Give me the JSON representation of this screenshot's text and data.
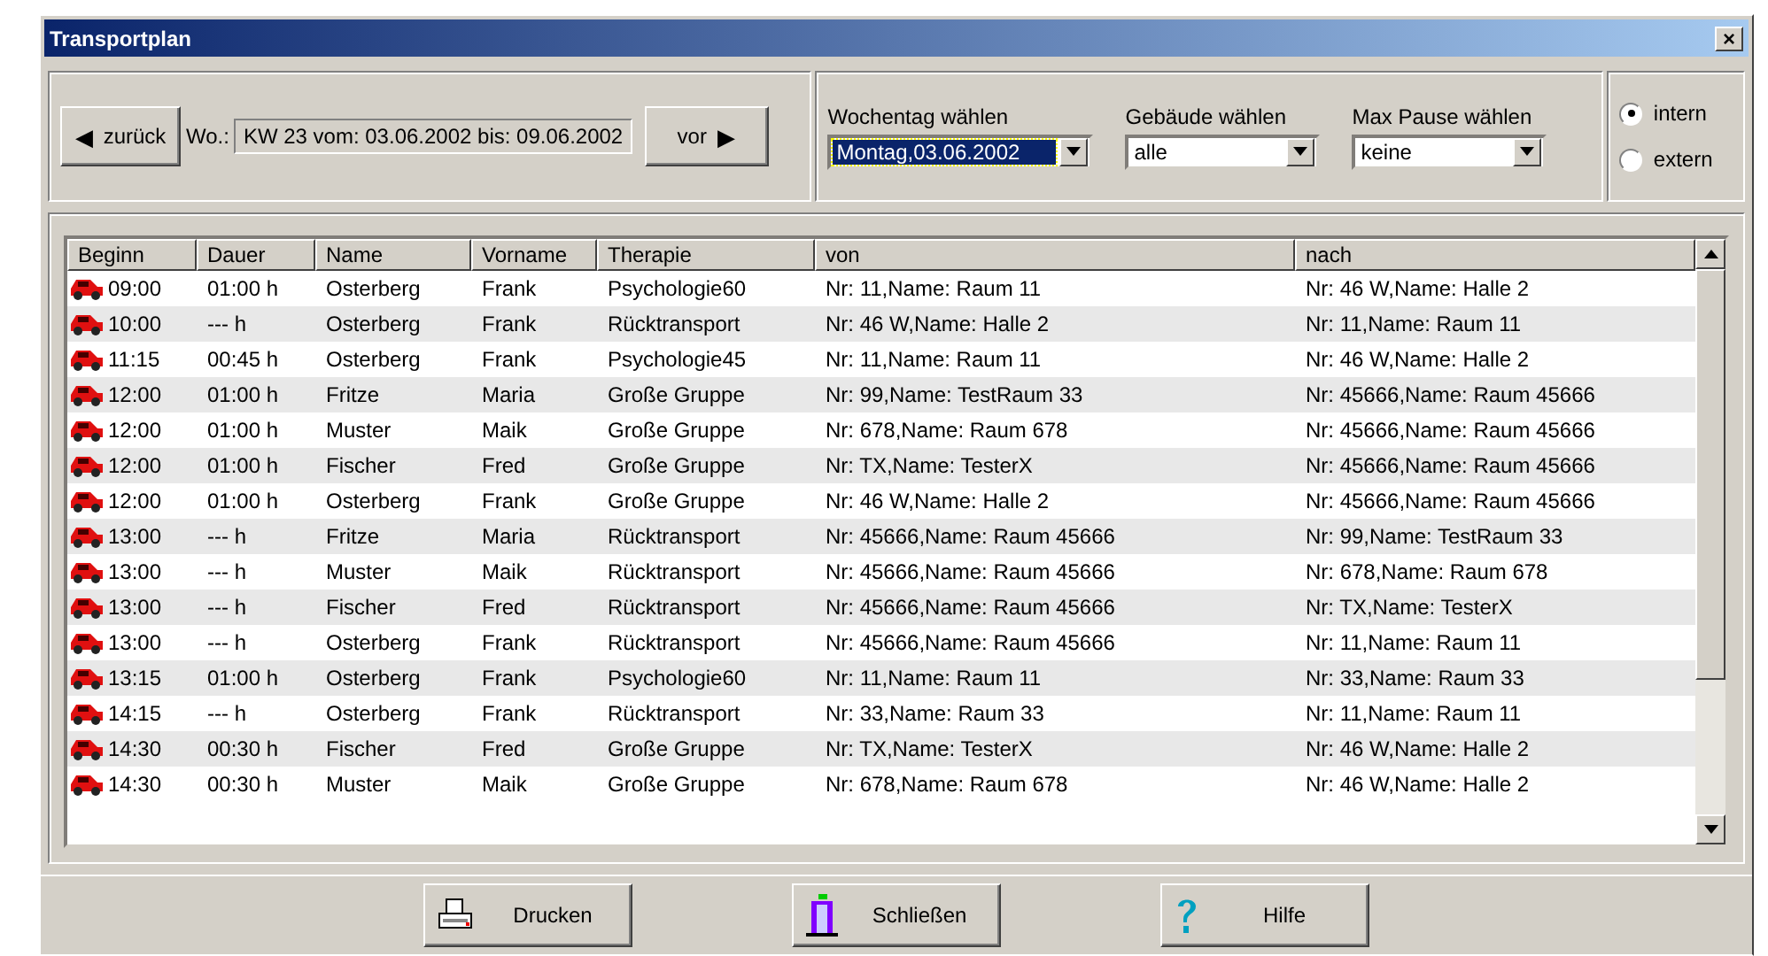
{
  "window": {
    "title": "Transportplan",
    "close": "×"
  },
  "week_nav": {
    "back": {
      "arrow": "◀",
      "label": "zurück"
    },
    "week_label": "Wo.:",
    "week_value": "KW 23 vom: 03.06.2002 bis: 09.06.2002",
    "forward": {
      "label": "vor",
      "arrow": "▶"
    }
  },
  "filters": [
    {
      "label": "Wochentag wählen",
      "value": "Montag,03.06.2002",
      "highlighted": true
    },
    {
      "label": "Gebäude wählen",
      "value": "alle",
      "highlighted": false
    },
    {
      "label": "Max Pause wählen",
      "value": "keine",
      "highlighted": false
    }
  ],
  "scope": [
    {
      "label": "intern",
      "selected": true
    },
    {
      "label": "extern",
      "selected": false
    }
  ],
  "table": {
    "columns": [
      "Beginn",
      "Dauer",
      "Name",
      "Vorname",
      "Therapie",
      "von",
      "nach"
    ],
    "rows": [
      [
        "09:00",
        "01:00 h",
        "Osterberg",
        "Frank",
        "Psychologie60",
        "Nr: 11,Name: Raum 11",
        "Nr: 46 W,Name: Halle 2"
      ],
      [
        "10:00",
        "--- h",
        "Osterberg",
        "Frank",
        "Rücktransport",
        "Nr: 46 W,Name: Halle 2",
        "Nr: 11,Name: Raum 11"
      ],
      [
        "11:15",
        "00:45 h",
        "Osterberg",
        "Frank",
        "Psychologie45",
        "Nr: 11,Name: Raum 11",
        "Nr: 46 W,Name: Halle 2"
      ],
      [
        "12:00",
        "01:00 h",
        "Fritze",
        "Maria",
        "Große Gruppe",
        "Nr: 99,Name: TestRaum 33",
        "Nr: 45666,Name: Raum 45666"
      ],
      [
        "12:00",
        "01:00 h",
        "Muster",
        "Maik",
        "Große Gruppe",
        "Nr: 678,Name: Raum 678",
        "Nr: 45666,Name: Raum 45666"
      ],
      [
        "12:00",
        "01:00 h",
        "Fischer",
        "Fred",
        "Große Gruppe",
        "Nr: TX,Name: TesterX",
        "Nr: 45666,Name: Raum 45666"
      ],
      [
        "12:00",
        "01:00 h",
        "Osterberg",
        "Frank",
        "Große Gruppe",
        "Nr: 46 W,Name: Halle 2",
        "Nr: 45666,Name: Raum 45666"
      ],
      [
        "13:00",
        "--- h",
        "Fritze",
        "Maria",
        "Rücktransport",
        "Nr: 45666,Name: Raum 45666",
        "Nr: 99,Name: TestRaum 33"
      ],
      [
        "13:00",
        "--- h",
        "Muster",
        "Maik",
        "Rücktransport",
        "Nr: 45666,Name: Raum 45666",
        "Nr: 678,Name: Raum 678"
      ],
      [
        "13:00",
        "--- h",
        "Fischer",
        "Fred",
        "Rücktransport",
        "Nr: 45666,Name: Raum 45666",
        "Nr: TX,Name: TesterX"
      ],
      [
        "13:00",
        "--- h",
        "Osterberg",
        "Frank",
        "Rücktransport",
        "Nr: 45666,Name: Raum 45666",
        "Nr: 11,Name: Raum 11"
      ],
      [
        "13:15",
        "01:00 h",
        "Osterberg",
        "Frank",
        "Psychologie60",
        "Nr: 11,Name: Raum 11",
        "Nr: 33,Name: Raum 33"
      ],
      [
        "14:15",
        "--- h",
        "Osterberg",
        "Frank",
        "Rücktransport",
        "Nr: 33,Name: Raum 33",
        "Nr: 11,Name: Raum 11"
      ],
      [
        "14:30",
        "00:30 h",
        "Fischer",
        "Fred",
        "Große Gruppe",
        "Nr: TX,Name: TesterX",
        "Nr: 46 W,Name: Halle 2"
      ],
      [
        "14:30",
        "00:30 h",
        "Muster",
        "Maik",
        "Große Gruppe",
        "Nr: 678,Name: Raum 678",
        "Nr: 46 W,Name: Halle 2"
      ]
    ]
  },
  "buttons": [
    {
      "kind": "print",
      "label": "Drucken"
    },
    {
      "kind": "close",
      "label": "Schließen"
    },
    {
      "kind": "help",
      "label": "Hilfe"
    }
  ]
}
